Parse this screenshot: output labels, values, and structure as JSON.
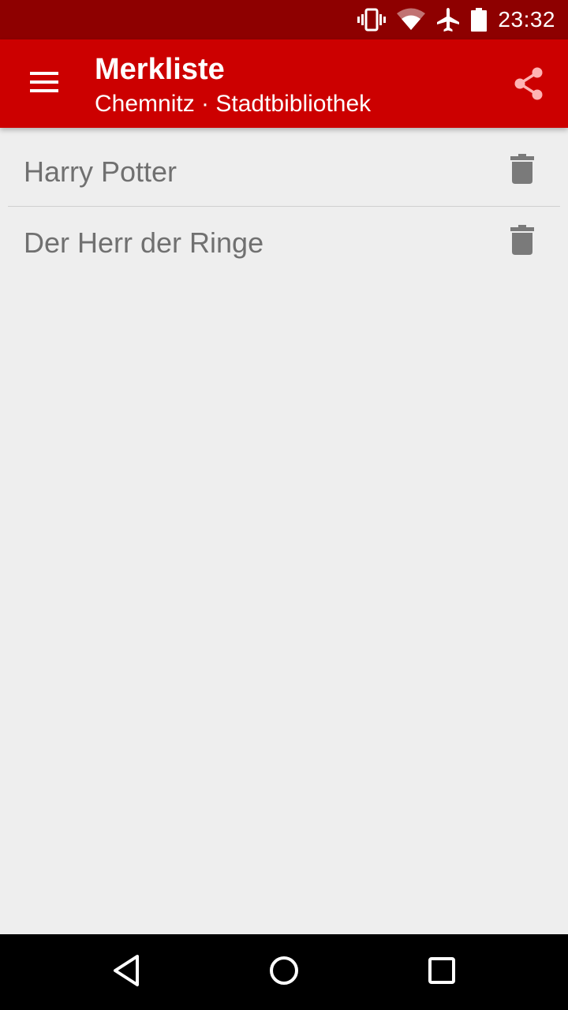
{
  "status_bar": {
    "time": "23:32",
    "icons": [
      "vibrate-icon",
      "wifi-icon",
      "airplane-icon",
      "battery-icon"
    ]
  },
  "app_bar": {
    "title": "Merkliste",
    "subtitle": "Chemnitz · Stadtbibliothek",
    "menu_icon": "hamburger-menu-icon",
    "share_icon": "share-icon"
  },
  "list": {
    "items": [
      {
        "title": "Harry Potter",
        "action_icon": "trash-icon"
      },
      {
        "title": "Der Herr der Ringe",
        "action_icon": "trash-icon"
      }
    ]
  },
  "nav_bar": {
    "icons": [
      "back-icon",
      "home-icon",
      "recents-icon"
    ]
  },
  "colors": {
    "status_bar": "#8e0000",
    "app_bar": "#cc0000",
    "background": "#eeeeee",
    "item_text": "#707070",
    "icon_gray": "#7a7a7a",
    "share_icon": "#ffb3b3"
  }
}
